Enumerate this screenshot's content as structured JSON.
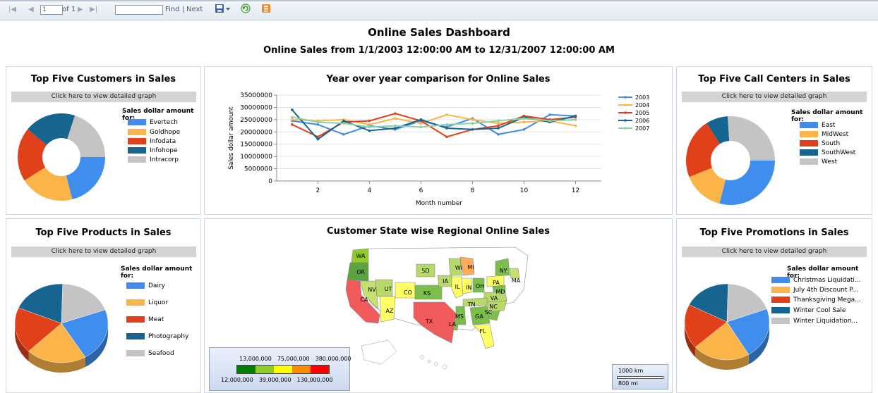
{
  "toolbar": {
    "page_value": "1",
    "page_of": "of 1",
    "find_label": "Find",
    "separator": "|",
    "next_label": "Next"
  },
  "dashboard": {
    "title": "Online Sales Dashboard",
    "subtitle": "Online Sales from 1/1/2003 12:00:00 AM to 12/31/2007 12:00:00 AM"
  },
  "graph_button_label": "Click here to view detailed graph",
  "legend_header": "Sales dollar amount for:",
  "customers": {
    "title": "Top Five Customers in Sales",
    "items": [
      {
        "label": "Evertech",
        "color": "#3f8ded"
      },
      {
        "label": "Goldhope",
        "color": "#fbb447"
      },
      {
        "label": "Infodata",
        "color": "#e0411a"
      },
      {
        "label": "Infohope",
        "color": "#166590"
      },
      {
        "label": "Intracorp",
        "color": "#c4c4c4"
      }
    ]
  },
  "call_centers": {
    "title": "Top Five Call Centers in Sales",
    "items": [
      {
        "label": "East",
        "color": "#3f8ded"
      },
      {
        "label": "MidWest",
        "color": "#fbb447"
      },
      {
        "label": "South",
        "color": "#e0411a"
      },
      {
        "label": "SouthWest",
        "color": "#166590"
      },
      {
        "label": "West",
        "color": "#c4c4c4"
      }
    ]
  },
  "products": {
    "title": "Top Five Products in Sales",
    "items": [
      {
        "label": "Dairy",
        "color": "#3f8ded"
      },
      {
        "label": "Liquor",
        "color": "#fbb447"
      },
      {
        "label": "Meat",
        "color": "#e0411a"
      },
      {
        "label": "Photography",
        "color": "#166590"
      },
      {
        "label": "Seafood",
        "color": "#c4c4c4"
      }
    ]
  },
  "promotions": {
    "title": "Top Five Promotions in Sales",
    "items": [
      {
        "label": "Christmas Liquidati...",
        "color": "#3f8ded"
      },
      {
        "label": "July 4th Discount P...",
        "color": "#fbb447"
      },
      {
        "label": "Thanksgiving Mega...",
        "color": "#e0411a"
      },
      {
        "label": "Winter Cool Sale",
        "color": "#166590"
      },
      {
        "label": "Winter Liquidation...",
        "color": "#c4c4c4"
      }
    ]
  },
  "yoy": {
    "title": "Year over year comparison for Online Sales"
  },
  "map": {
    "title": "Customer State wise Regional Online Sales",
    "state_labels": [
      "WA",
      "OR",
      "MI",
      "SD",
      "WI",
      "NY",
      "MA",
      "CA",
      "NV",
      "UT",
      "CO",
      "KS",
      "IA",
      "IL",
      "IN",
      "OH",
      "PA",
      "MD",
      "VA",
      "NC",
      "TN",
      "SC",
      "GA",
      "MS",
      "AZ",
      "TX",
      "LA",
      "FL"
    ],
    "scale_top": [
      "13,000,000",
      "75,000,000",
      "380,000,000"
    ],
    "scale_bottom": [
      "12,000,000",
      "39,000,000",
      "130,000,000"
    ],
    "scale_colors": [
      "#008000",
      "#8fcc26",
      "#ffff00",
      "#ff8c00",
      "#ff0000"
    ],
    "distance_km": "1000 km",
    "distance_mi": "800 mi"
  },
  "chart_data": [
    {
      "type": "line",
      "title": "Year over year comparison for Online Sales",
      "xlabel": "Month number",
      "ylabel": "Sales dollar amount",
      "x": [
        1,
        2,
        3,
        4,
        5,
        6,
        7,
        8,
        9,
        10,
        11,
        12
      ],
      "xticks": [
        2,
        4,
        6,
        8,
        10,
        12
      ],
      "ylim": [
        0,
        35000000
      ],
      "yticks": [
        0,
        5000000,
        10000000,
        15000000,
        20000000,
        25000000,
        30000000,
        35000000
      ],
      "ytick_labels": [
        "0",
        "5000000",
        "10000000",
        "15000000",
        "20000000",
        "25000000",
        "30000000",
        "35000000"
      ],
      "grid": true,
      "legend_position": "right",
      "series": [
        {
          "name": "2003",
          "color": "#3f8ded",
          "values": [
            24500000,
            23000000,
            19000000,
            22500000,
            21000000,
            24500000,
            22000000,
            25500000,
            19000000,
            21000000,
            27000000,
            26500000
          ]
        },
        {
          "name": "2004",
          "color": "#fbb447",
          "values": [
            25000000,
            24500000,
            25000000,
            23000000,
            25500000,
            23500000,
            27000000,
            25000000,
            23500000,
            24000000,
            24500000,
            22500000
          ]
        },
        {
          "name": "2005",
          "color": "#e0411a",
          "values": [
            23000000,
            18000000,
            24000000,
            24500000,
            27500000,
            24500000,
            18000000,
            21000000,
            22500000,
            26500000,
            25000000,
            26000000
          ]
        },
        {
          "name": "2006",
          "color": "#166590",
          "values": [
            29000000,
            17000000,
            24500000,
            20500000,
            21500000,
            25000000,
            21500000,
            21000000,
            21500000,
            26000000,
            24000000,
            26500000
          ]
        },
        {
          "name": "2007",
          "color": "#8dd0a8",
          "values": [
            26000000,
            24000000,
            23500000,
            22000000,
            22500000,
            22000000,
            23000000,
            23500000,
            24500000,
            25500000,
            24500000,
            25000000
          ]
        }
      ]
    },
    {
      "type": "pie",
      "title": "Top Five Customers in Sales",
      "labels": [
        "Evertech",
        "Goldhope",
        "Infodata",
        "Infohope",
        "Intracorp"
      ],
      "values": [
        21,
        20,
        20,
        19,
        20
      ]
    },
    {
      "type": "pie",
      "title": "Top Five Call Centers in Sales",
      "labels": [
        "East",
        "MidWest",
        "South",
        "SouthWest",
        "West"
      ],
      "values": [
        29,
        15,
        22,
        8,
        26
      ]
    },
    {
      "type": "pie",
      "title": "Top Five Products in Sales",
      "labels": [
        "Dairy",
        "Liquor",
        "Meat",
        "Photography",
        "Seafood"
      ],
      "values": [
        22,
        21,
        19,
        19,
        19
      ]
    },
    {
      "type": "pie",
      "title": "Top Five Promotions in Sales",
      "labels": [
        "Christmas Liquidati...",
        "July 4th Discount P...",
        "Thanksgiving Mega...",
        "Winter Cool Sale",
        "Winter Liquidation..."
      ],
      "values": [
        22,
        22,
        19,
        18,
        19
      ]
    }
  ]
}
